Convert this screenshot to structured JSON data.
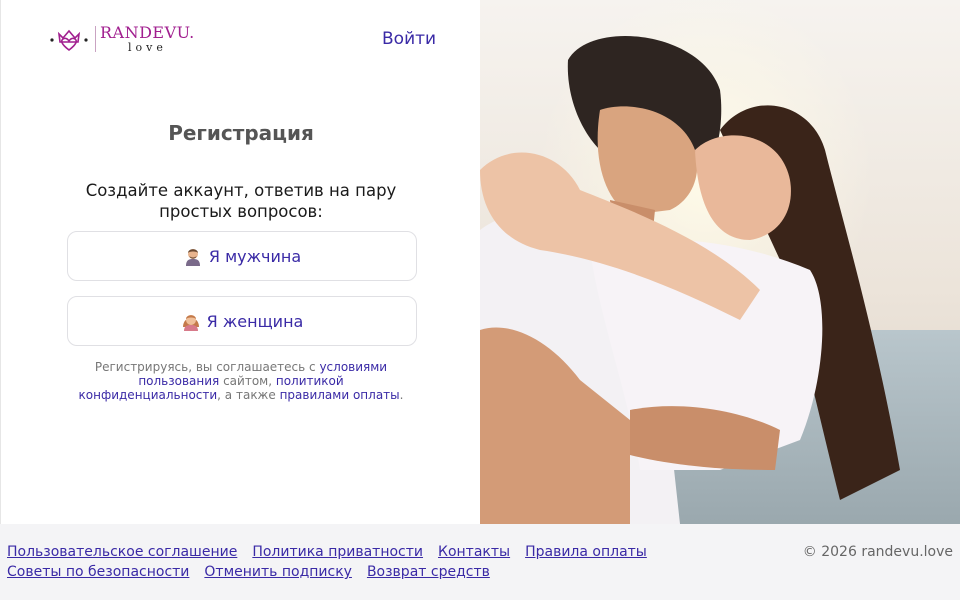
{
  "header": {
    "brand": "RANDEVU.",
    "brand_sub": "love",
    "login_label": "Войти"
  },
  "registration": {
    "title": "Регистрация",
    "subtitle": "Создайте аккаунт, ответив на пару простых вопросов:",
    "male_label": "Я мужчина",
    "female_label": "Я женщина",
    "terms": {
      "t1": "Регистрируясь, вы соглашаетесь с ",
      "link_terms": "условиями пользования",
      "t2": " сайтом, ",
      "link_privacy": "политикой конфиденциальности",
      "t3": ", а также ",
      "link_payment": "правилами оплаты",
      "t4": "."
    }
  },
  "hero": {
    "icon": "couple-photo"
  },
  "footer": {
    "row1": [
      "Пользовательское соглашение",
      "Политика приватности",
      "Контакты",
      "Правила оплаты"
    ],
    "row2": [
      "Советы по безопасности",
      "Отменить подписку",
      "Возврат средств"
    ],
    "copyright": "© 2026 randevu.love"
  },
  "colors": {
    "accent": "#3a2aa6",
    "brand": "#a11f8f"
  }
}
